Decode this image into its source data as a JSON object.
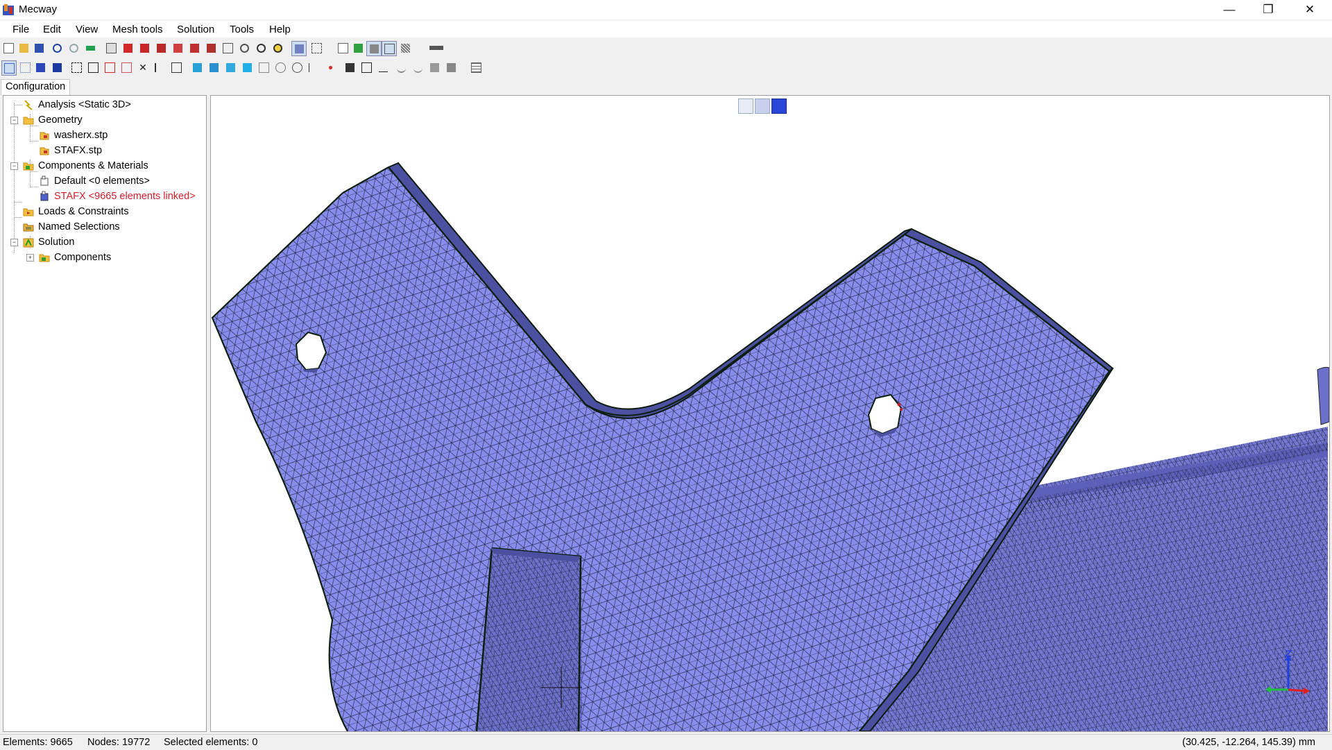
{
  "window": {
    "title": "Mecway"
  },
  "menu": [
    "File",
    "Edit",
    "View",
    "Mesh tools",
    "Solution",
    "Tools",
    "Help"
  ],
  "tabs": {
    "configuration": "Configuration"
  },
  "tree": {
    "analysis": "Analysis <Static 3D>",
    "geometry": "Geometry",
    "geometry_items": [
      "washerx.stp",
      "STAFX.stp"
    ],
    "components": "Components & Materials",
    "component_items": [
      "Default <0 elements>",
      "STAFX <9665 elements linked>"
    ],
    "loads": "Loads & Constraints",
    "named": "Named Selections",
    "solution": "Solution",
    "solution_items": [
      "Components"
    ]
  },
  "status": {
    "elements": "Elements: 9665",
    "nodes": "Nodes: 19772",
    "selected": "Selected elements: 0",
    "coords": "(30.425, -12.264, 145.39) mm"
  },
  "colors": {
    "mesh_fill": "#8a8ee8",
    "mesh_shade": "#6d71c8",
    "linked_text": "#d4202c"
  }
}
